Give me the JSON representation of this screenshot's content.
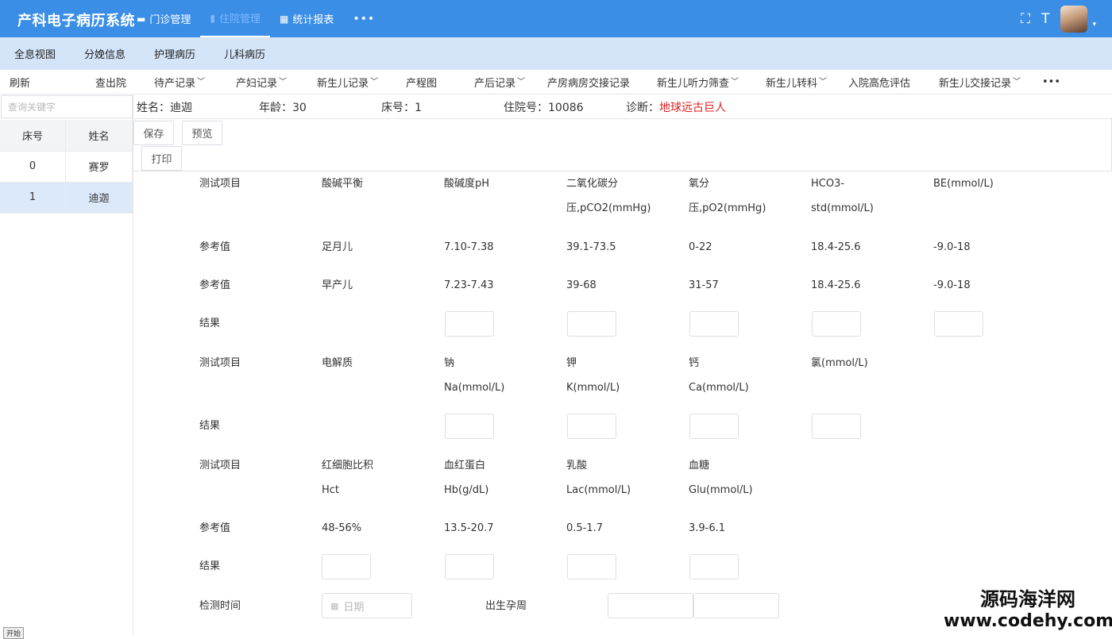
{
  "app": {
    "title": "产科电子病历系统"
  },
  "topnav": [
    {
      "icon": "▬",
      "label": "门诊管理"
    },
    {
      "icon": "▮",
      "label": "住院管理"
    },
    {
      "icon": "▦",
      "label": "统计报表"
    },
    {
      "label": "•••"
    }
  ],
  "top_right": {
    "fullscreen_icon": "⛶",
    "fontsize_icon": "T",
    "caret": "▾"
  },
  "tabs2": [
    "全息视图",
    "分娩信息",
    "护理病历",
    "儿科病历"
  ],
  "toolbar": {
    "refresh": "刷新",
    "discharged": "查出院",
    "items": [
      "待产记录",
      "产妇记录",
      "新生儿记录",
      "产程图",
      "产后记录",
      "产房病房交接记录",
      "新生儿听力筛查",
      "新生儿转科",
      "入院高危评估",
      "新生儿交接记录"
    ],
    "more": "•••"
  },
  "search": {
    "placeholder": "查询关键字"
  },
  "patients": {
    "headers": [
      "床号",
      "姓名"
    ],
    "rows": [
      [
        "0",
        "赛罗"
      ],
      [
        "1",
        "迪迦"
      ]
    ]
  },
  "start_btn": "开始",
  "info": {
    "name": "姓名：迪迦",
    "age": "年龄：30",
    "bed": "床号：1",
    "admission": "住院号：10086",
    "diagnosis_label": "诊断：",
    "diagnosis": "地球远古巨人"
  },
  "buttons": {
    "save": "保存",
    "preview": "预览",
    "print": "打印"
  },
  "form": {
    "r1": [
      "测试项目",
      "酸碱平衡",
      "酸碱度pH",
      "二氧化碳分",
      "氧分",
      "HCO3-",
      "BE(mmol/L)"
    ],
    "r1b": [
      "压,pCO2(mmHg)",
      "压,pO2(mmHg)",
      "std(mmol/L)"
    ],
    "r2": [
      "参考值",
      "足月儿",
      "7.10-7.38",
      "39.1-73.5",
      "0-22",
      "18.4-25.6",
      "-9.0-18"
    ],
    "r3": [
      "参考值",
      "早产儿",
      "7.23-7.43",
      "39-68",
      "31-57",
      "18.4-25.6",
      "-9.0-18"
    ],
    "r4": "结果",
    "r5": [
      "测试项目",
      "电解质",
      "钠",
      "钾",
      "钙",
      "氯(mmol/L)"
    ],
    "r5b": [
      "Na(mmol/L)",
      "K(mmol/L)",
      "Ca(mmol/L)"
    ],
    "r6": "结果",
    "r7": [
      "测试项目",
      "红细胞比积",
      "血红蛋白",
      "乳酸",
      "血糖"
    ],
    "r7b": [
      "Hct",
      "Hb(g/dL)",
      "Lac(mmol/L)",
      "Glu(mmol/L)"
    ],
    "r8": [
      "参考值",
      "48-56%",
      "13.5-20.7",
      "0.5-1.7",
      "3.9-6.1"
    ],
    "r9": "结果",
    "r10": {
      "label": "检测时间",
      "date_placeholder": "日期",
      "week_label": "出生孕周"
    }
  },
  "watermark": {
    "line1": "源码海洋网",
    "line2": "www.codehy.com"
  }
}
